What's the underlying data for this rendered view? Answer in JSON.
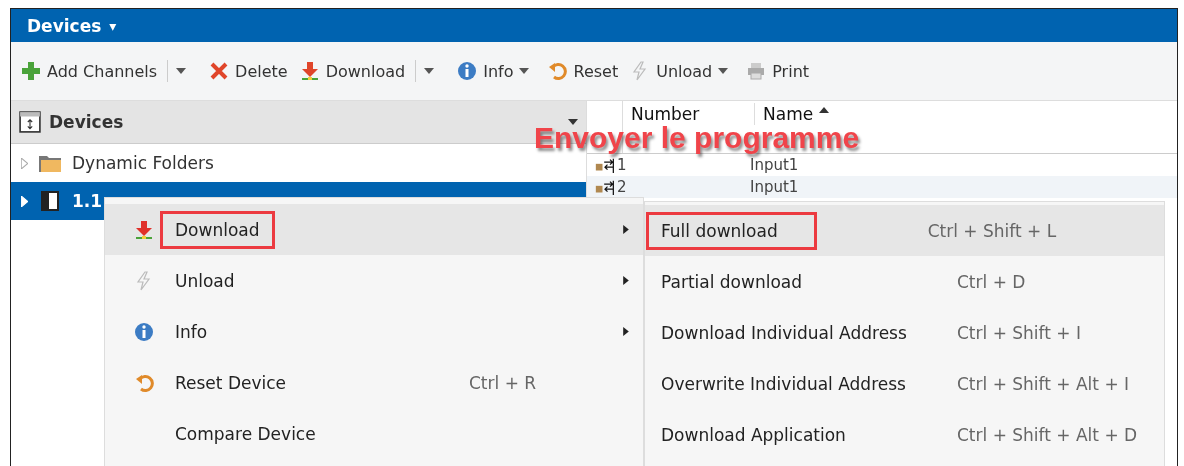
{
  "window": {
    "title": "Devices",
    "title_caret": "▾"
  },
  "toolbar": [
    {
      "label": "Add Channels",
      "kind": "plus",
      "dropdown": true,
      "split": true
    },
    {
      "label": "Delete",
      "kind": "cross",
      "dropdown": false
    },
    {
      "label": "Download",
      "kind": "download",
      "dropdown": true,
      "split": true
    },
    {
      "label": "Info",
      "kind": "info",
      "dropdown": true,
      "split": false
    },
    {
      "label": "Reset",
      "kind": "reset",
      "dropdown": false
    },
    {
      "label": "Unload",
      "kind": "bolt",
      "dropdown": true,
      "split": false
    },
    {
      "label": "Print",
      "kind": "printer",
      "dropdown": false
    }
  ],
  "tree": {
    "header": "Devices",
    "items": [
      {
        "label": "Dynamic Folders",
        "kind": "folder",
        "selected": false
      },
      {
        "label": "1.1",
        "kind": "device",
        "selected": true
      }
    ]
  },
  "grid": {
    "columns": [
      {
        "label": "Number",
        "sorted": false
      },
      {
        "label": "Name",
        "sorted": true
      }
    ],
    "rows": [
      {
        "number": "1",
        "name": "Input1"
      },
      {
        "number": "2",
        "name": "Input1"
      }
    ]
  },
  "annotation": "Envoyer le programme",
  "context_menu": [
    {
      "label": "Download",
      "kind": "download",
      "submenu": true,
      "selected": true,
      "highlighted": true
    },
    {
      "label": "Unload",
      "kind": "bolt",
      "submenu": true,
      "selected": false,
      "highlighted": false
    },
    {
      "label": "Info",
      "kind": "info",
      "submenu": true,
      "selected": false,
      "highlighted": false
    },
    {
      "label": "Reset Device",
      "kind": "reset",
      "shortcut": "Ctrl + R",
      "submenu": false,
      "selected": false,
      "highlighted": false
    },
    {
      "label": "Compare Device",
      "kind": "plain",
      "submenu": false,
      "selected": false,
      "highlighted": false
    }
  ],
  "submenu": [
    {
      "label": "Full download",
      "shortcut": "Ctrl + Shift + L",
      "selected": true,
      "highlighted": true
    },
    {
      "label": "Partial download",
      "shortcut": "Ctrl + D",
      "selected": false,
      "highlighted": false
    },
    {
      "label": "Download Individual Address",
      "shortcut": "Ctrl + Shift + I",
      "selected": false,
      "highlighted": false
    },
    {
      "label": "Overwrite Individual Address",
      "shortcut": "Ctrl + Shift + Alt + I",
      "selected": false,
      "highlighted": false
    },
    {
      "label": "Download Application",
      "shortcut": "Ctrl + Shift + Alt + D",
      "selected": false,
      "highlighted": false
    }
  ]
}
